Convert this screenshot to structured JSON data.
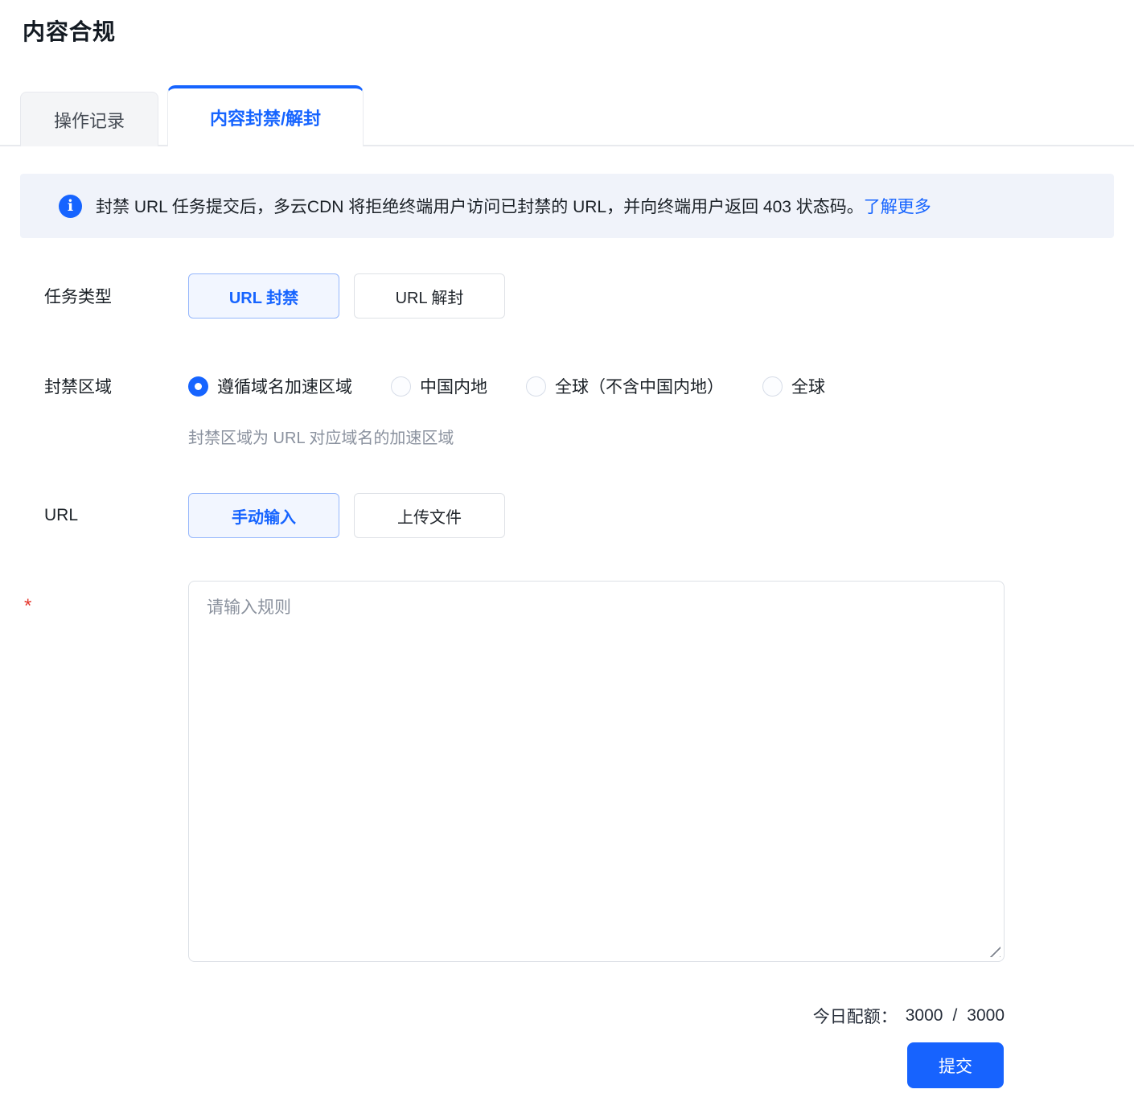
{
  "page": {
    "title": "内容合规",
    "accent_color": "#1664FF",
    "background": "#FFFFFF"
  },
  "tabs": [
    {
      "label": "操作记录",
      "active": false
    },
    {
      "label": "内容封禁/解封",
      "active": true
    }
  ],
  "banner": {
    "icon": "info-icon",
    "icon_glyph": "i",
    "background": "#F0F3FA",
    "text": "封禁 URL 任务提交后，多云CDN 将拒绝终端用户访问已封禁的 URL，并向终端用户返回 403 状态码。",
    "link": "了解更多"
  },
  "form": {
    "task_type": {
      "label": "任务类型",
      "options": [
        {
          "label": "URL 封禁",
          "selected": true
        },
        {
          "label": "URL 解封",
          "selected": false
        }
      ]
    },
    "block_region": {
      "label": "封禁区域",
      "options": [
        {
          "label": "遵循域名加速区域",
          "selected": true
        },
        {
          "label": "中国内地",
          "selected": false
        },
        {
          "label": "全球（不含中国内地）",
          "selected": false
        },
        {
          "label": "全球",
          "selected": false
        }
      ],
      "helper": "封禁区域为 URL 对应域名的加速区域"
    },
    "url_input_mode": {
      "label": "URL",
      "options": [
        {
          "label": "手动输入",
          "selected": true
        },
        {
          "label": "上传文件",
          "selected": false
        }
      ]
    },
    "rules_input": {
      "required_mark": "*",
      "placeholder": "请输入规则",
      "value": ""
    },
    "quota": {
      "label": "今日配额：",
      "used": "3000",
      "separator": "/",
      "total": "3000"
    },
    "submit_label": "提交"
  }
}
